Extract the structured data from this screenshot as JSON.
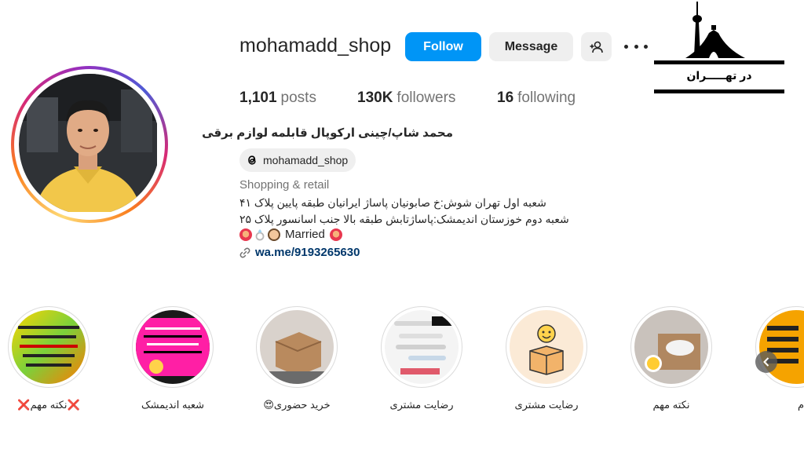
{
  "profile": {
    "username": "mohamadd_shop",
    "follow_label": "Follow",
    "message_label": "Message",
    "stats": [
      {
        "count": "1,101",
        "label": "posts"
      },
      {
        "count": "130K",
        "label": "followers"
      },
      {
        "count": "16",
        "label": "following"
      }
    ],
    "display_name": "محمد شاپ/چینی ارکوپال قابلمه لوازم برقی",
    "threads_handle": "mohamadd_shop",
    "category": "Shopping & retail",
    "bio_line1": "شعبه اول تهران شوش:خ صابونیان پاساژ ایرانیان طبقه پایین پلاک ۴۱",
    "bio_line2": "شعبه دوم خوزستان اندیمشک:پاساژتابش طبقه بالا جنب اسانسور پلاک ۲۵",
    "married_text": "Married",
    "link": "wa.me/9193265630"
  },
  "watermark": {
    "text": "در تهـــــران"
  },
  "highlights": [
    {
      "label": "❌نکته مهم❌"
    },
    {
      "label": "شعبه اندیمشک"
    },
    {
      "label": "خرید حضوری😍"
    },
    {
      "label": "رضایت مشتری"
    },
    {
      "label": "رضایت مشتری"
    },
    {
      "label": "نکته مهم"
    },
    {
      "label": "م"
    }
  ],
  "colors": {
    "follow_button": "#0095f6",
    "secondary_button": "#efefef",
    "link": "#00376b",
    "muted_text": "#737373"
  }
}
